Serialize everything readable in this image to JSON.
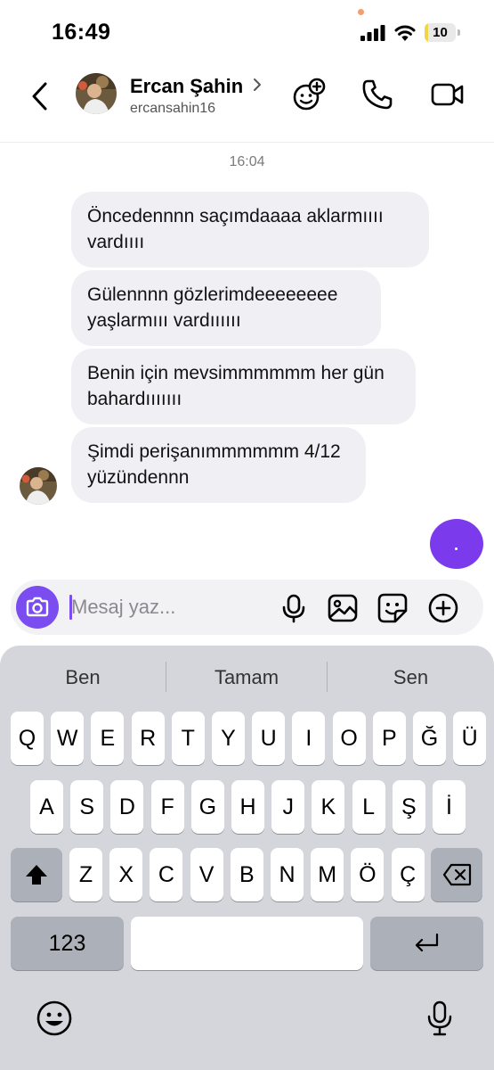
{
  "status_bar": {
    "time": "16:49",
    "battery": "10",
    "battery_level": 0.1
  },
  "header": {
    "contact_name": "Ercan Şahin",
    "username": "ercansahin16",
    "icons": [
      "back-chevron-icon",
      "chevron-right-icon",
      "add-effect-icon",
      "phone-icon",
      "video-icon"
    ]
  },
  "chat": {
    "timestamp": "16:04",
    "messages": [
      {
        "text": "Öncedennnn saçımdaaaa aklarmıııı vardıııı"
      },
      {
        "text": "Gülennnn gözlerimdeeeeeeee yaşlarmııı vardıııııı"
      },
      {
        "text": "Benin için mevsimmmmmm her gün bahardııııııı"
      },
      {
        "text": "Şimdi perişanımmmmmm 4/12 yüzündennn"
      }
    ]
  },
  "composer": {
    "placeholder": "Mesaj yaz...",
    "icons": [
      "camera-icon",
      "microphone-icon",
      "image-icon",
      "sticker-icon",
      "plus-circle-icon"
    ]
  },
  "keyboard": {
    "suggestions": [
      "Ben",
      "Tamam",
      "Sen"
    ],
    "row1": [
      "Q",
      "W",
      "E",
      "R",
      "T",
      "Y",
      "U",
      "I",
      "O",
      "P",
      "Ğ",
      "Ü"
    ],
    "row2": [
      "A",
      "S",
      "D",
      "F",
      "G",
      "H",
      "J",
      "K",
      "L",
      "Ş",
      "İ"
    ],
    "row3": [
      "Z",
      "X",
      "C",
      "V",
      "B",
      "N",
      "M",
      "Ö",
      "Ç"
    ],
    "numbers_label": "123",
    "icons": [
      "shift-icon",
      "backspace-icon",
      "return-icon",
      "emoji-icon",
      "dictation-icon"
    ]
  }
}
